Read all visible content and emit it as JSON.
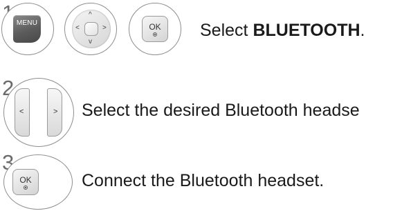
{
  "steps": [
    {
      "number": "1",
      "text_prefix": "Select ",
      "text_bold": "BLUETOOTH",
      "text_suffix": ".",
      "buttons": [
        "menu-button",
        "navigation-pad",
        "ok-button"
      ]
    },
    {
      "number": "2",
      "text": "Select the desired Bluetooth headse",
      "buttons": [
        "left-right-buttons"
      ]
    },
    {
      "number": "3",
      "text": "Connect the Bluetooth headset.",
      "buttons": [
        "ok-button"
      ]
    }
  ],
  "keys": {
    "menu_label": "MENU",
    "ok_label": "OK",
    "arrow_up": "^",
    "arrow_down": "v",
    "arrow_left": "<",
    "arrow_right": ">"
  }
}
